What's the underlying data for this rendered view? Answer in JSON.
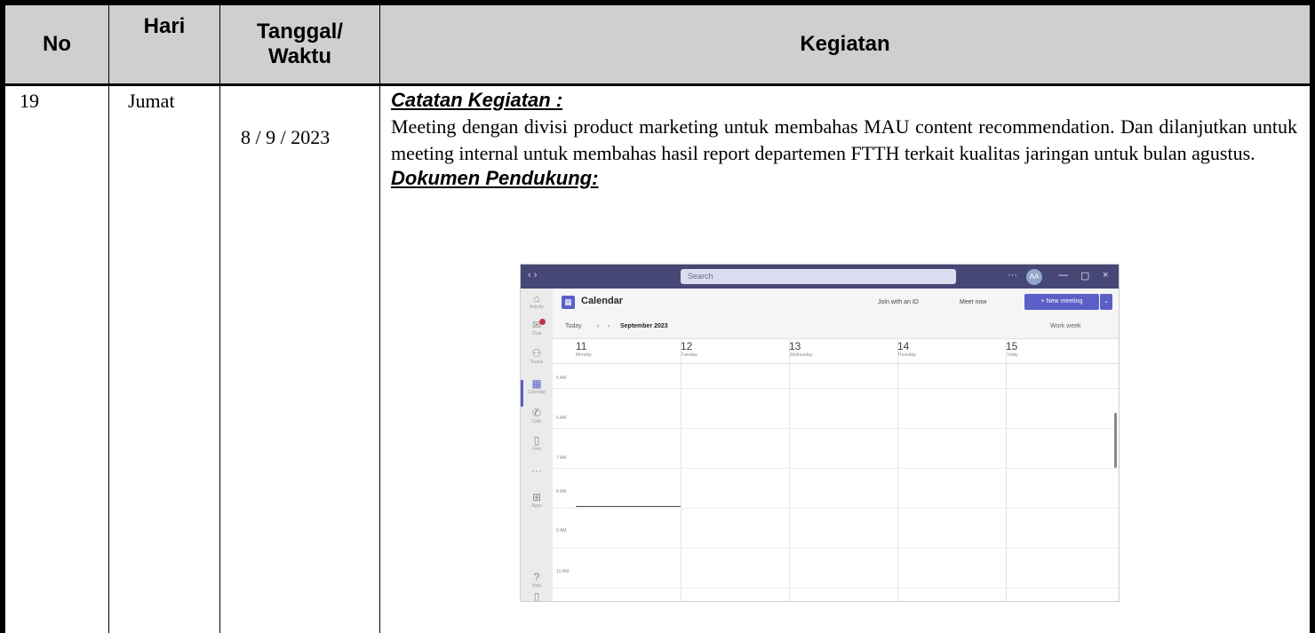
{
  "table": {
    "headers": {
      "no": "No",
      "hari": "Hari",
      "tanggal": "Tanggal/\nWaktu",
      "kegiatan": "Kegiatan"
    },
    "row": {
      "no": "19",
      "hari": "Jumat",
      "tanggal": "8 / 9 / 2023",
      "catatan_title": "Catatan Kegiatan :",
      "catatan_body": "Meeting dengan divisi product marketing untuk membahas MAU content recommendation. Dan dilanjutkan untuk meeting internal untuk membahas hasil report departemen FTTH terkait kualitas jaringan untuk bulan agustus.",
      "dokumen_title": "Dokumen Pendukung:"
    }
  },
  "screenshot": {
    "titlebar": {
      "search_placeholder": "Search",
      "avatar_initials": "AA"
    },
    "rail": [
      {
        "icon": "activity-icon",
        "label": "Activity"
      },
      {
        "icon": "chat-icon",
        "label": "Chat"
      },
      {
        "icon": "teams-icon",
        "label": "Teams"
      },
      {
        "icon": "calendar-icon",
        "label": "Calendar"
      },
      {
        "icon": "calls-icon",
        "label": "Calls"
      },
      {
        "icon": "files-icon",
        "label": "Files"
      },
      {
        "icon": "more-icon",
        "label": ""
      },
      {
        "icon": "apps-icon",
        "label": "Apps"
      },
      {
        "icon": "help-icon",
        "label": "Help"
      }
    ],
    "header": {
      "title": "Calendar",
      "join_label": "Join with an ID",
      "meet_label": "Meet now",
      "new_meeting_label": "+ New meeting"
    },
    "toolbar": {
      "today": "Today",
      "month": "September 2023",
      "view": "Work week"
    },
    "days": [
      {
        "num": "11",
        "name": "Monday"
      },
      {
        "num": "12",
        "name": "Tuesday"
      },
      {
        "num": "13",
        "name": "Wednesday"
      },
      {
        "num": "14",
        "name": "Thursday"
      },
      {
        "num": "15",
        "name": "Friday"
      }
    ],
    "times": [
      "5 AM",
      "6 AM",
      "7 AM",
      "8 AM",
      "9 AM",
      "10 AM"
    ]
  }
}
